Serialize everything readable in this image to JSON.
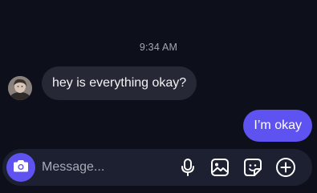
{
  "conversation": {
    "timestamp": "9:34 AM",
    "messages": [
      {
        "direction": "incoming",
        "text": "hey is everything okay?"
      },
      {
        "direction": "outgoing",
        "text": "I’m okay"
      }
    ]
  },
  "composer": {
    "placeholder": "Message...",
    "icons": [
      "camera-icon",
      "microphone-icon",
      "image-icon",
      "sticker-icon",
      "plus-icon"
    ]
  },
  "colors": {
    "background": "#0d0f1b",
    "incoming_bubble": "#262935",
    "outgoing_bubble": "#5e52f0",
    "composer": "#1d2030"
  }
}
